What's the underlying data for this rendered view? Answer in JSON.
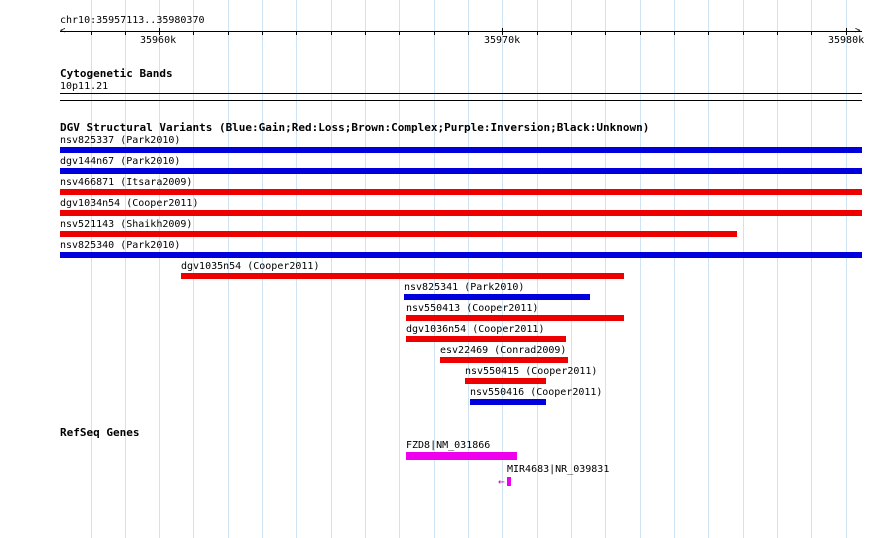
{
  "ruler": {
    "position": "chr10:35957113..35980370",
    "ticks": [
      "35960k",
      "35970k",
      "35980k"
    ]
  },
  "cytobands": {
    "title": "Cytogenetic Bands",
    "band": "10p11.21"
  },
  "dgv": {
    "title": "DGV Structural Variants (Blue:Gain;Red:Loss;Brown:Complex;Purple:Inversion;Black:Unknown)",
    "colors": {
      "gain": "#0000dd",
      "loss": "#ee0000"
    },
    "variants": [
      {
        "label": "nsv825337 (Park2010)",
        "type": "gain"
      },
      {
        "label": "dgv144n67 (Park2010)",
        "type": "gain"
      },
      {
        "label": "nsv466871 (Itsara2009)",
        "type": "loss"
      },
      {
        "label": "dgv1034n54 (Cooper2011)",
        "type": "loss"
      },
      {
        "label": "nsv521143 (Shaikh2009)",
        "type": "loss"
      },
      {
        "label": "nsv825340 (Park2010)",
        "type": "gain"
      },
      {
        "label": "dgv1035n54 (Cooper2011)",
        "type": "loss"
      },
      {
        "label": "nsv825341 (Park2010)",
        "type": "gain"
      },
      {
        "label": "nsv550413 (Cooper2011)",
        "type": "loss"
      },
      {
        "label": "dgv1036n54 (Cooper2011)",
        "type": "loss"
      },
      {
        "label": "esv22469 (Conrad2009)",
        "type": "loss"
      },
      {
        "label": "nsv550415 (Cooper2011)",
        "type": "loss"
      },
      {
        "label": "nsv550416 (Cooper2011)",
        "type": "gain"
      }
    ]
  },
  "refseq": {
    "title": "RefSeq Genes",
    "color": "#ee00ee",
    "genes": [
      {
        "label": "FZD8|NM_031866"
      },
      {
        "label": "MIR4683|NR_039831",
        "strand_glyph": "←"
      }
    ]
  }
}
